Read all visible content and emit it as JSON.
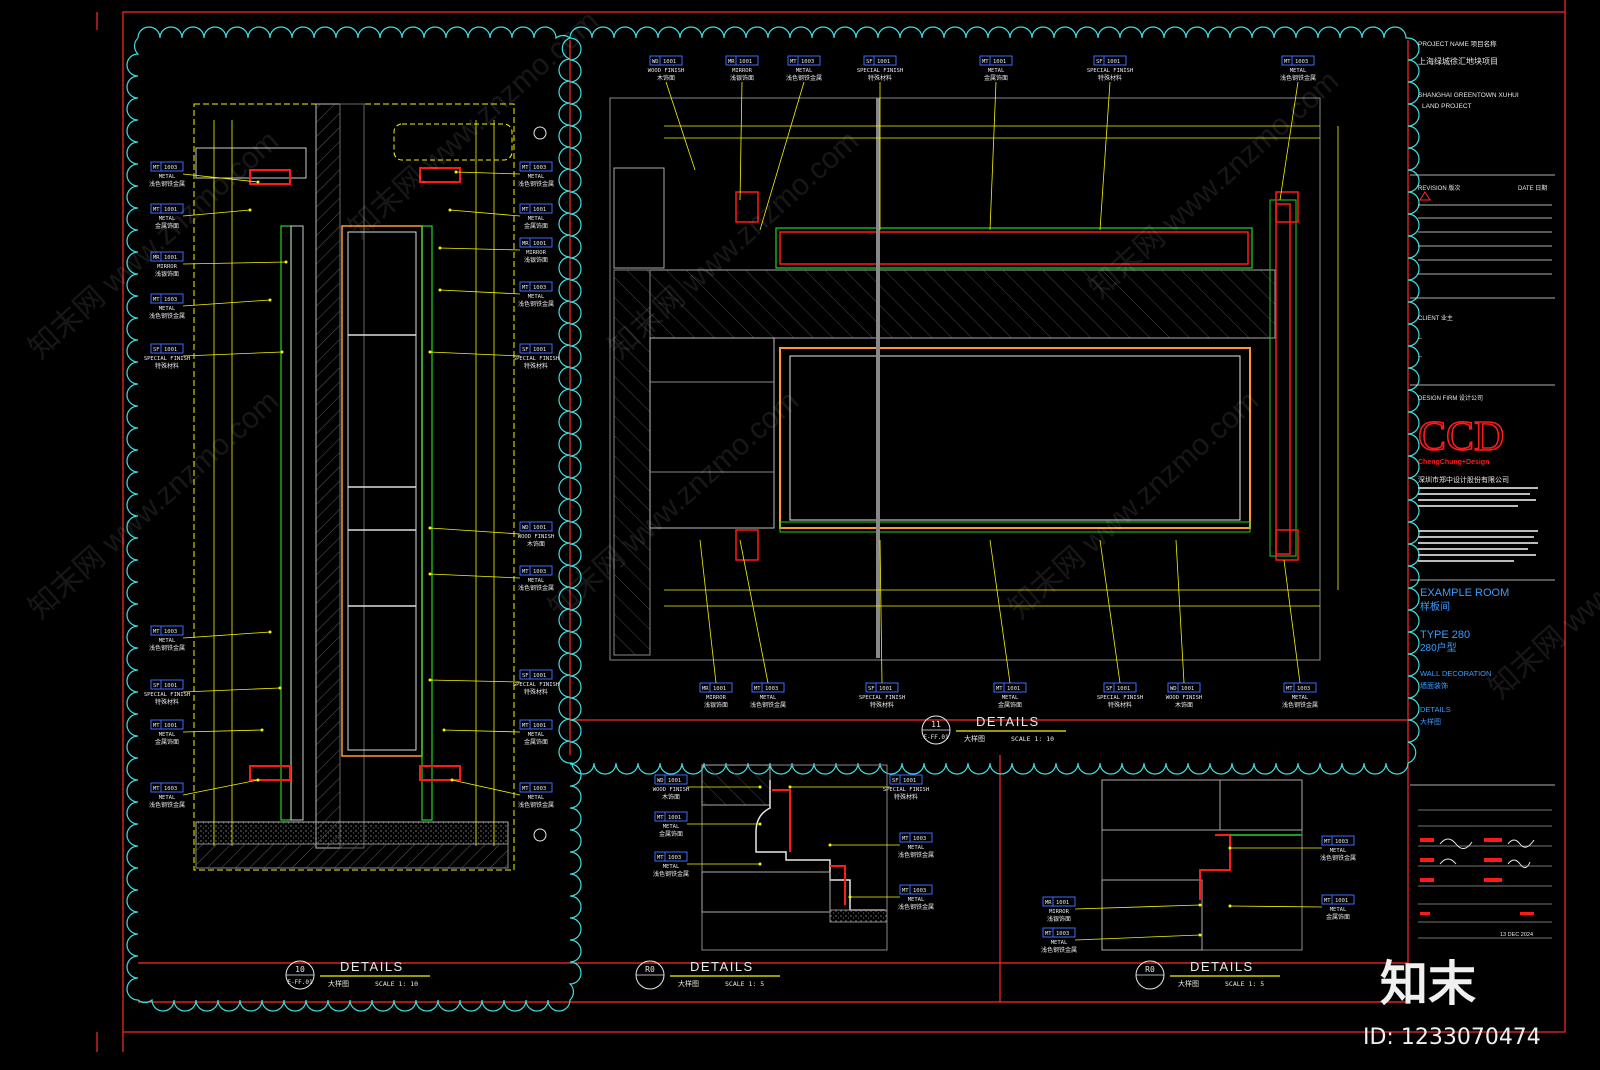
{
  "title_block": {
    "project_name_label": "PROJECT NAME 项目名称",
    "project_name_cn": "上海绿城徐汇地块项目",
    "project_name_en_1": "SHANGHAI GREENTOWN XUHUI",
    "project_name_en_2": "LAND PROJECT",
    "revision_label": "REVISION 版次",
    "date_label": "DATE 日期",
    "client_label": "CLIENT 业主",
    "client_value_1": "--",
    "client_value_2": "--",
    "design_firm_label": "DESIGN FIRM 设计公司",
    "firm_logo": "CCD",
    "firm_logo_sub": "ChengChung+Design",
    "firm_name_cn": "深圳市郑中设计股份有限公司",
    "room_en": "EXAMPLE ROOM",
    "room_cn": "样板间",
    "type_en": "TYPE 280",
    "type_cn": "280户型",
    "drawing_en": "WALL DECORATION",
    "drawing_cn": "墙面装饰",
    "details_en": "DETAILS",
    "details_cn": "大样图",
    "date_value": "13 DEC 2024"
  },
  "callout_labels": {
    "MT1003": {
      "code": "MT 1003",
      "en": "METAL",
      "cn": "浅色钢铁金属"
    },
    "MT1001": {
      "code": "MT 1001",
      "en": "METAL",
      "cn": "金属饰面"
    },
    "MR1001": {
      "code": "MR 1001",
      "en": "MIRROR",
      "cn": "浅银饰面"
    },
    "SF1001": {
      "code": "SF 1001",
      "en": "SPECIAL FINISH",
      "cn": "特殊材料"
    },
    "WD1001": {
      "code": "WD 1001",
      "en": "WOOD FINISH",
      "cn": "木饰面"
    }
  },
  "views": [
    {
      "number": "10",
      "ref": "E-FF.01",
      "title": "DETAILS",
      "subtitle": "大样图",
      "scale": "SCALE 1: 10"
    },
    {
      "number": "11",
      "ref": "E-FF.01",
      "title": "DETAILS",
      "subtitle": "大样图",
      "scale": "SCALE 1: 10"
    },
    {
      "number": "R0",
      "ref": "",
      "title": "DETAILS",
      "subtitle": "大样图",
      "scale": "SCALE 1: 5"
    },
    {
      "number": "R0",
      "ref": "",
      "title": "DETAILS",
      "subtitle": "大样图",
      "scale": "SCALE 1: 5"
    }
  ],
  "watermark": {
    "logo": "知末",
    "id": "ID: 1233070474",
    "site": "www.znzmo.com",
    "brand": "知末网"
  },
  "colors": {
    "frame": "#ff2a2a",
    "cloud": "#3fe0e0",
    "yellow": "#f5f500",
    "white": "#e8e8e8",
    "red": "#ff1a1a",
    "green": "#22d422",
    "blue": "#3b6bff",
    "orange": "#ff9a2a"
  }
}
